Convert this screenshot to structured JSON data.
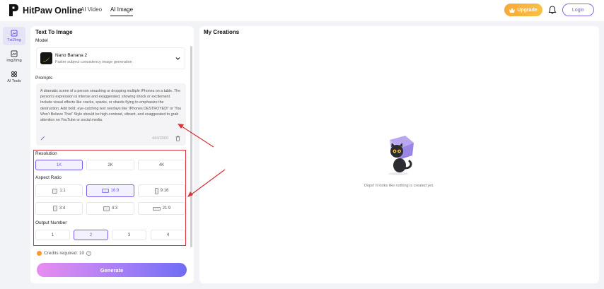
{
  "header": {
    "brand": "HitPaw Online",
    "nav": [
      "AI Video",
      "AI Image"
    ],
    "upgrade_label": "Upgrade",
    "login_label": "Login",
    "icons": {
      "logo": "hitpaw-logo-icon",
      "bell": "bell-icon",
      "crown": "crown-icon"
    }
  },
  "sidebar": {
    "items": [
      {
        "label": "Txt2Img",
        "icon": "text-image-icon",
        "active": true
      },
      {
        "label": "Img2Img",
        "icon": "image-image-icon",
        "active": false
      },
      {
        "label": "AI Tools",
        "icon": "tools-icon",
        "active": false
      }
    ]
  },
  "left_panel": {
    "title": "Text To Image",
    "model_label": "Model",
    "model": {
      "name": "Nano Banana 2",
      "description": "Faster subject consistency image generation"
    },
    "prompts_label": "Prompts",
    "prompt": "A dramatic scene of a person smashing or dropping multiple iPhones on a table. The person's expression is intense and exaggerated, showing shock or excitement. Include visual effects like cracks, sparks, or shards flying to emphasize the destruction. Add bold, eye-catching text overlays like 'iPhones DESTROYED!' or 'You Won't Believe This!' Style should be high-contrast, vibrant, and exaggerated to grab attention on YouTube or social media.",
    "prompt_counter": "444/2000",
    "resolution_label": "Resolution",
    "resolutions": [
      "1K",
      "2K",
      "4K"
    ],
    "resolution_selected": "1K",
    "aspect_label": "Aspect Ratio",
    "aspect_ratios": [
      "1:1",
      "16:9",
      "9:16",
      "3:4",
      "4:3",
      "21:9"
    ],
    "aspect_selected": "16:9",
    "output_label": "Output Number",
    "outputs": [
      "1",
      "2",
      "3",
      "4"
    ],
    "output_selected": "2",
    "credits_text": "Credits required: 10",
    "generate_label": "Generate"
  },
  "right_panel": {
    "title": "My Creations",
    "empty_text": "Oops! It looks like nothing is created yet."
  },
  "colors": {
    "accent": "#6d5ff2",
    "upgrade": "#f6a93b",
    "annotation": "#d8343b",
    "background": "#f2f3f6"
  }
}
